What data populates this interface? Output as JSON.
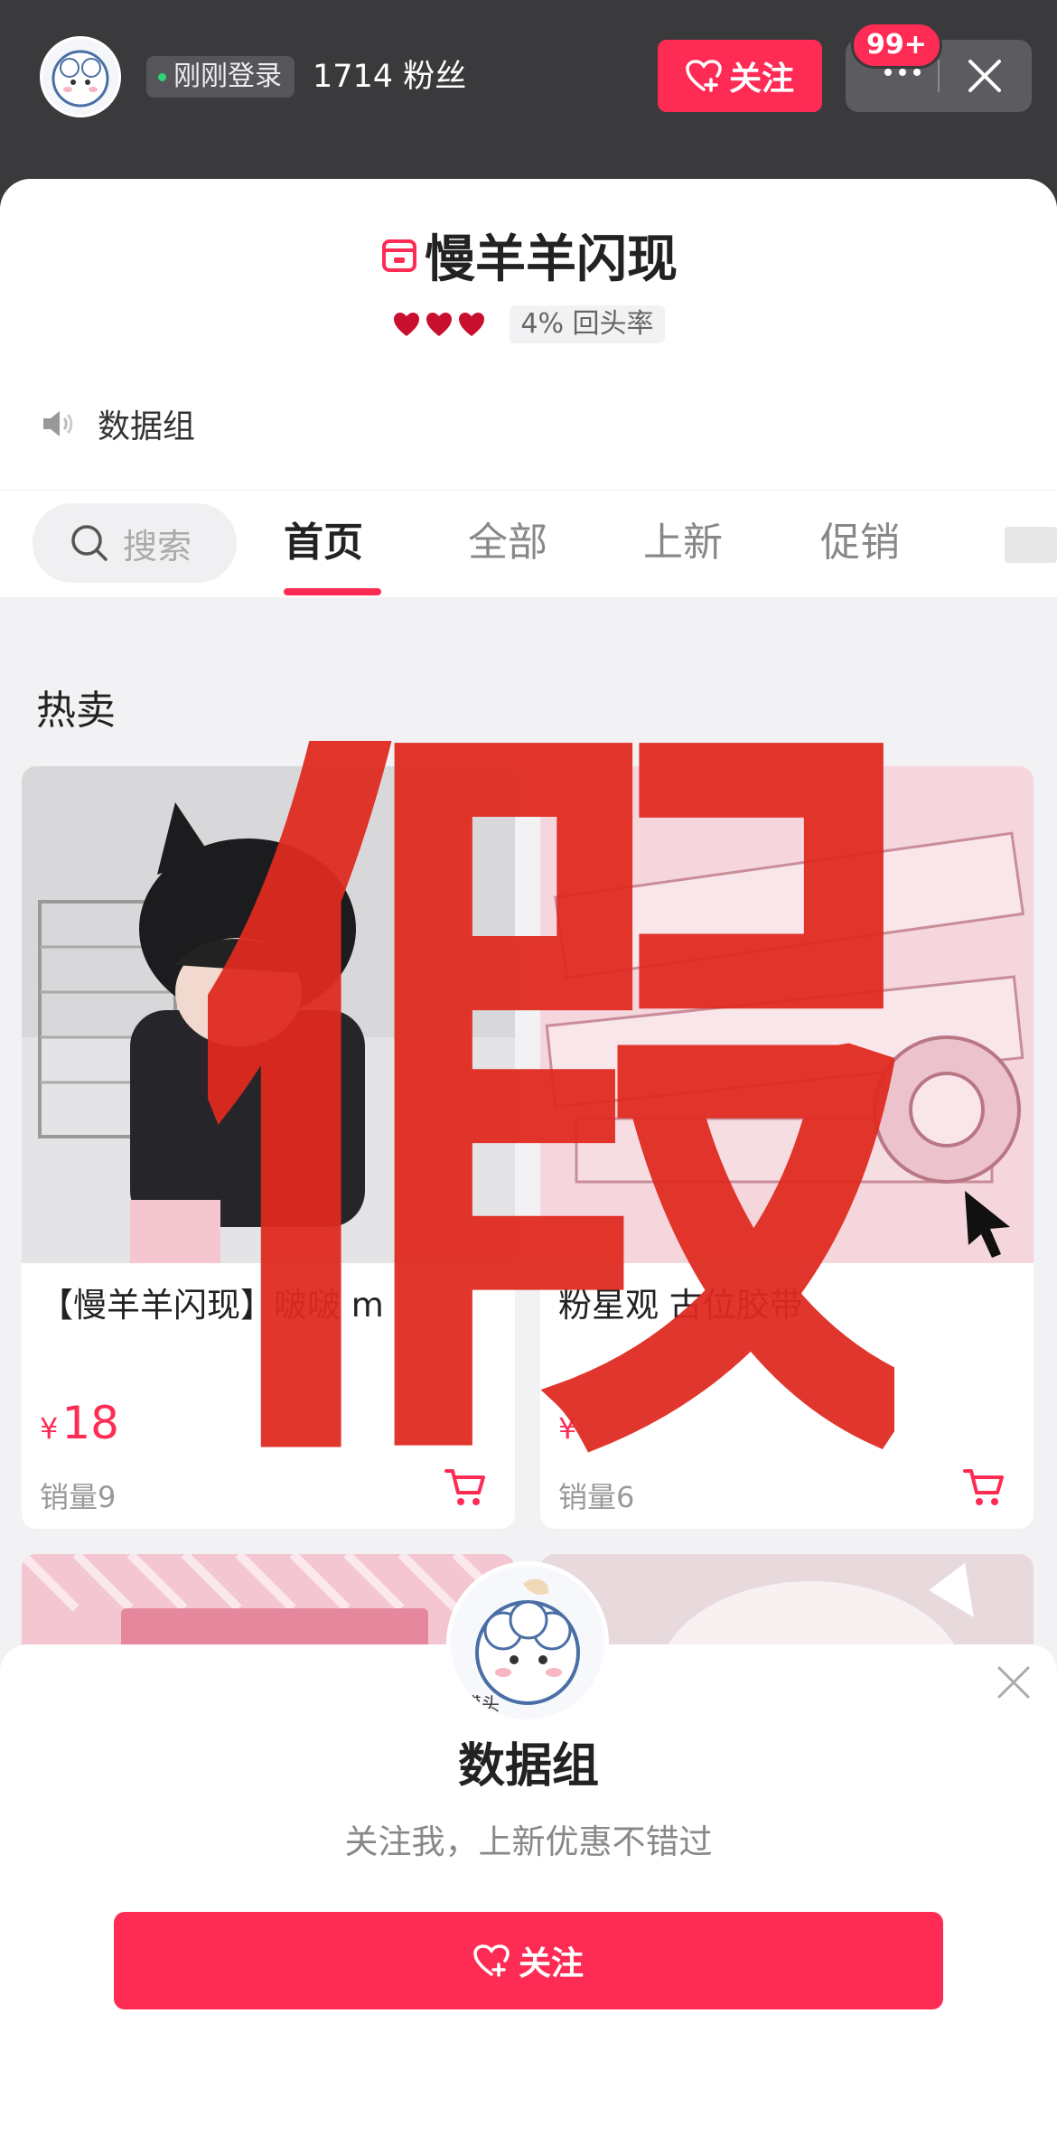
{
  "header": {
    "status": "刚刚登录",
    "fans": "1714 粉丝",
    "follow_label": "关注",
    "badge": "99+"
  },
  "shop": {
    "name": "慢羊羊闪现",
    "repeat_rate": "4% 回头率",
    "notice": "数据组"
  },
  "search": {
    "placeholder": "搜索"
  },
  "tabs": [
    {
      "label": "首页",
      "active": true
    },
    {
      "label": "全部"
    },
    {
      "label": "上新"
    },
    {
      "label": "促销"
    }
  ],
  "section": {
    "title": "热卖"
  },
  "products": [
    {
      "title": "【慢羊羊闪现】啵啵 m",
      "currency": "¥",
      "price": "18",
      "sales": "销量9"
    },
    {
      "title": "粉星观 古位胶带",
      "currency": "¥",
      "price": "",
      "sales": "销量6"
    }
  ],
  "watermark": "假",
  "popup": {
    "title": "数据组",
    "subtitle": "关注我，上新优惠不错过",
    "button_label": "关注",
    "avatar_caption": "摸头"
  },
  "colors": {
    "accent": "#fe2c55",
    "watermark": "#e02a20",
    "topbar": "#3a3a3c"
  }
}
